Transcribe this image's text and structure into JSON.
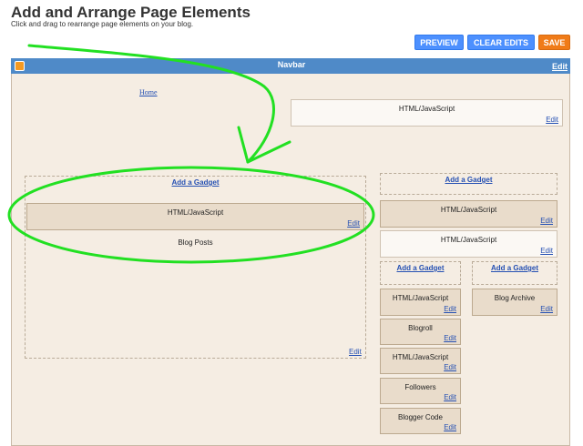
{
  "header": {
    "title": "Add and Arrange Page Elements",
    "subtitle": "Click and drag to rearrange page elements on your blog."
  },
  "toolbar": {
    "preview_label": "PREVIEW",
    "clear_edits_label": "CLEAR EDITS",
    "save_label": "SAVE"
  },
  "navbar": {
    "title": "Navbar",
    "edit_label": "Edit",
    "logo_icon": "blogger-logo-icon"
  },
  "header_area": {
    "home_link": "Home",
    "top_widget": {
      "title": "HTML/JavaScript",
      "edit_label": "Edit"
    }
  },
  "main_column": {
    "add_gadget_label": "Add a Gadget",
    "widget_html": {
      "title": "HTML/JavaScript",
      "edit_label": "Edit"
    },
    "blog_posts": {
      "title": "Blog Posts",
      "edit_label": "Edit"
    }
  },
  "sidebar_top": {
    "add_gadget_label": "Add a Gadget",
    "widgets": [
      {
        "title": "HTML/JavaScript",
        "edit_label": "Edit"
      },
      {
        "title": "HTML/JavaScript",
        "edit_label": "Edit"
      }
    ]
  },
  "sidebar_left": {
    "add_gadget_label": "Add a Gadget",
    "widgets": [
      {
        "title": "HTML/JavaScript",
        "edit_label": "Edit"
      },
      {
        "title": "Blogroll",
        "edit_label": "Edit"
      },
      {
        "title": "HTML/JavaScript",
        "edit_label": "Edit"
      },
      {
        "title": "Followers",
        "edit_label": "Edit"
      },
      {
        "title": "Blogger Code",
        "edit_label": "Edit"
      }
    ]
  },
  "sidebar_right": {
    "add_gadget_label": "Add a Gadget",
    "widgets": [
      {
        "title": "Blog Archive",
        "edit_label": "Edit"
      }
    ]
  },
  "colors": {
    "annotation_green": "#22e022",
    "navbar_blue": "#4f8ac8",
    "button_blue": "#4d90fe",
    "button_orange": "#f07b18",
    "canvas_bg": "#f5ede3"
  }
}
